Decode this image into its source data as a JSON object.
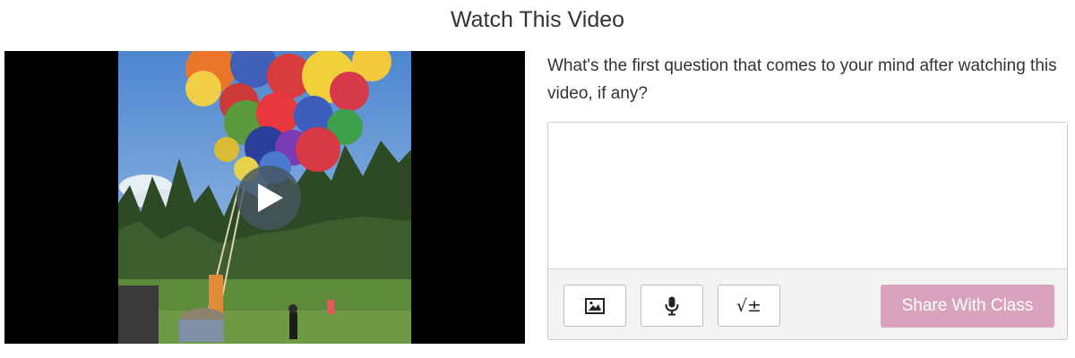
{
  "page": {
    "title": "Watch This Video"
  },
  "video": {
    "play_icon": "play-icon"
  },
  "question": {
    "prompt": "What's the first question that comes to your mind after watching this video, if any?",
    "answer_value": "",
    "answer_placeholder": ""
  },
  "toolbar": {
    "image_icon": "image-icon",
    "microphone_icon": "microphone-icon",
    "math_icon": "math-icon",
    "math_glyph": "√±",
    "share_label": "Share With Class"
  },
  "colors": {
    "share_button": "#d9a3bd",
    "toolbar_bg": "#f3f3f3",
    "play_button": "#46555f"
  }
}
